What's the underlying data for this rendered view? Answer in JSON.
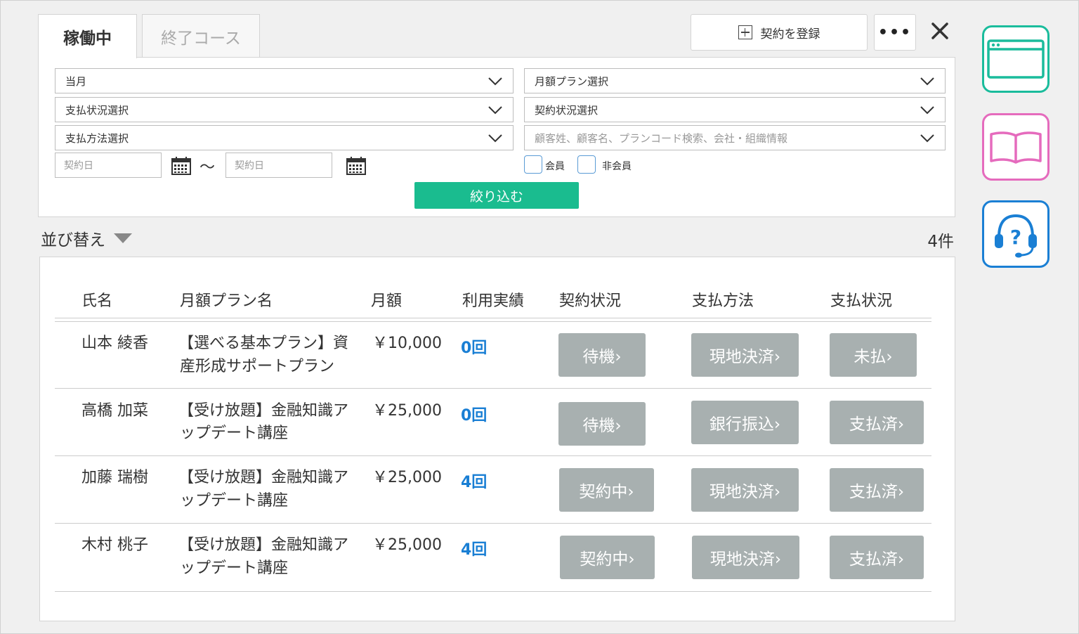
{
  "tabs": {
    "active": "稼働中",
    "inactive": "終了コース"
  },
  "toolbar": {
    "register_label": "契約を登録",
    "more_label": "•••"
  },
  "filters": {
    "month": "当月",
    "plan": "月額プラン選択",
    "payment_status": "支払状況選択",
    "contract_status": "契約状況選択",
    "payment_method": "支払方法選択",
    "search_placeholder": "顧客姓、顧客名、プランコード検索、会社・組織情報",
    "date_from_placeholder": "契約日",
    "date_to_placeholder": "契約日",
    "range_sep": "〜",
    "member_label": "会員",
    "nonmember_label": "非会員",
    "submit_label": "絞り込む"
  },
  "sort_label": "並び替え",
  "count_label": "4件",
  "table": {
    "headers": [
      "氏名",
      "月額プラン名",
      "月額",
      "利用実績",
      "契約状況",
      "支払方法",
      "支払状況"
    ],
    "rows": [
      {
        "name": "山本 綾香",
        "plan_line1": "【選べる基本プラン】資",
        "plan_line2": "産形成サポートプラン",
        "price": "￥10,000",
        "usage": "0回",
        "contract": "待機›",
        "method": "現地決済›",
        "payment": "未払›"
      },
      {
        "name": "高橋 加菜",
        "plan_line1": "【受け放題】金融知識ア",
        "plan_line2": "ップデート講座",
        "price": "￥25,000",
        "usage": "0回",
        "contract": "待機›",
        "method": "銀行振込›",
        "payment": "支払済›"
      },
      {
        "name": "加藤 瑞樹",
        "plan_line1": "【受け放題】金融知識ア",
        "plan_line2": "ップデート講座",
        "price": "￥25,000",
        "usage": "4回",
        "contract": "契約中›",
        "method": "現地決済›",
        "payment": "支払済›"
      },
      {
        "name": "木村 桃子",
        "plan_line1": "【受け放題】金融知識ア",
        "plan_line2": "ップデート講座",
        "price": "￥25,000",
        "usage": "4回",
        "contract": "契約中›",
        "method": "現地決済›",
        "payment": "支払済›"
      }
    ]
  },
  "colors": {
    "accent_green": "#1abc8f",
    "usage_blue": "#1a7fd4",
    "status_gray": "#a8b0b0",
    "side_teal": "#1abc9c",
    "side_pink": "#e56bbd",
    "side_blue": "#1a7fd4"
  },
  "side_icons": [
    "browser-window-icon",
    "open-book-icon",
    "help-headset-icon"
  ]
}
